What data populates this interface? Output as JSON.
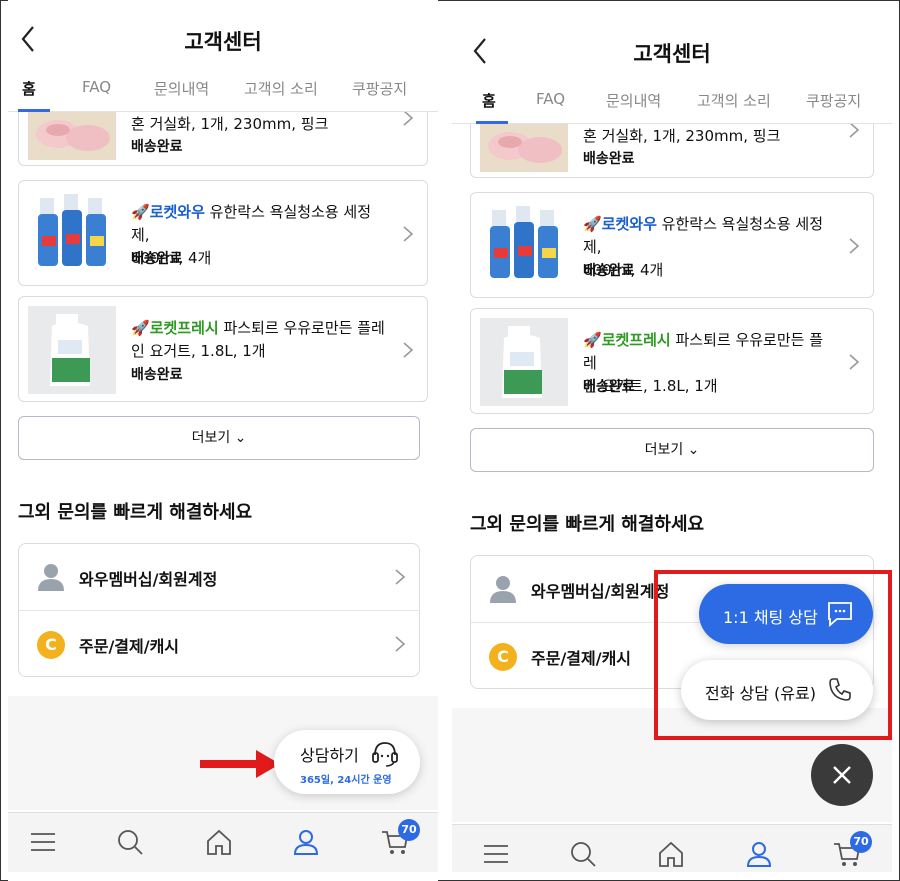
{
  "colors": {
    "accent": "#2d6be4",
    "highlight": "#e11b1b",
    "rocket_wow": "#1a5fd0",
    "rocket_fresh": "#2e9a22"
  },
  "header": {
    "title": "고객센터"
  },
  "tabs": [
    {
      "label": "홈",
      "active": true
    },
    {
      "label": "FAQ"
    },
    {
      "label": "문의내역"
    },
    {
      "label": "고객의 소리"
    },
    {
      "label": "쿠팡공지"
    }
  ],
  "orders": [
    {
      "partial_text": "혼 거실화, 1개, 230mm, 핑크",
      "status": "배송완료",
      "thumb": "slippers-image"
    },
    {
      "badge": "로켓와우",
      "name": "유한락스 욕실청소용 세정제, 600ml, 4개",
      "line1": "유한락스 욕실청소용 세정제,",
      "line2": "600ml, 4개",
      "status": "배송완료",
      "thumb": "cleaner-bottles-image"
    },
    {
      "badge": "로켓프레시",
      "name": "파스퇴르 우유로만든 플레인 요거트, 1.8L, 1개",
      "line1": "파스퇴르 우유로만든 플레",
      "line2": "인 요거트, 1.8L, 1개",
      "status": "배송완료",
      "thumb": "yogurt-bottle-image"
    }
  ],
  "more_button": "더보기",
  "section_title": "그외 문의를 빠르게 해결하세요",
  "help_items": [
    {
      "label": "와우멤버십/회원계정",
      "icon": "person-icon"
    },
    {
      "label": "주문/결제/캐시",
      "icon": "cash-c-icon",
      "icon_letter": "C"
    }
  ],
  "consult": {
    "label": "상담하기",
    "sub": "365일, 24시간 운영"
  },
  "chat_button": "1:1 채팅 상담",
  "phone_button": "전화 상담 (유료)",
  "cart_badge": "70",
  "bottom_nav": [
    "menu-icon",
    "search-icon",
    "home-icon",
    "my-icon",
    "cart-icon"
  ]
}
